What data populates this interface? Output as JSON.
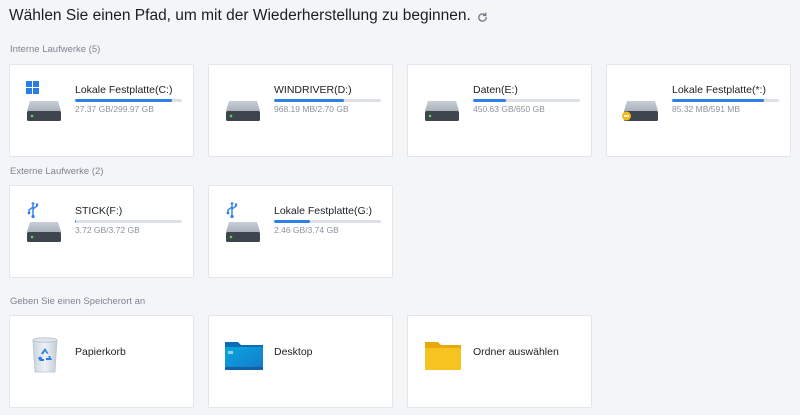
{
  "header": {
    "title": "Wählen Sie einen Pfad, um mit der Wiederherstellung zu beginnen."
  },
  "internal": {
    "label": "Interne Laufwerke (5)",
    "drives": [
      {
        "name": "Lokale Festplatte(C:)",
        "size": "27.37 GB/299.97 GB",
        "fill_pct": 91,
        "icon": "windows-drive-icon"
      },
      {
        "name": "WINDRIVER(D:)",
        "size": "968.19 MB/2.70 GB",
        "fill_pct": 65,
        "icon": "hard-drive-icon"
      },
      {
        "name": "Daten(E:)",
        "size": "450.63 GB/650 GB",
        "fill_pct": 31,
        "icon": "hard-drive-icon"
      },
      {
        "name": "Lokale Festplatte(*:)",
        "size": "85.32 MB/591 MB",
        "fill_pct": 86,
        "icon": "lost-partition-drive-icon"
      }
    ]
  },
  "external": {
    "label": "Externe Laufwerke (2)",
    "drives": [
      {
        "name": "STICK(F:)",
        "size": "3.72 GB/3.72 GB",
        "fill_pct": 1,
        "icon": "usb-drive-icon"
      },
      {
        "name": "Lokale Festplatte(G:)",
        "size": "2.46 GB/3.74 GB",
        "fill_pct": 34,
        "icon": "usb-drive-icon"
      }
    ]
  },
  "locations": {
    "label": "Geben Sie einen Speicherort an",
    "items": [
      {
        "name": "Papierkorb",
        "icon": "recycle-bin-icon"
      },
      {
        "name": "Desktop",
        "icon": "desktop-folder-icon"
      },
      {
        "name": "Ordner auswählen",
        "icon": "folder-icon"
      }
    ]
  },
  "colors": {
    "accent": "#2f7fe8",
    "background": "#f4f5f7",
    "card": "#ffffff"
  }
}
